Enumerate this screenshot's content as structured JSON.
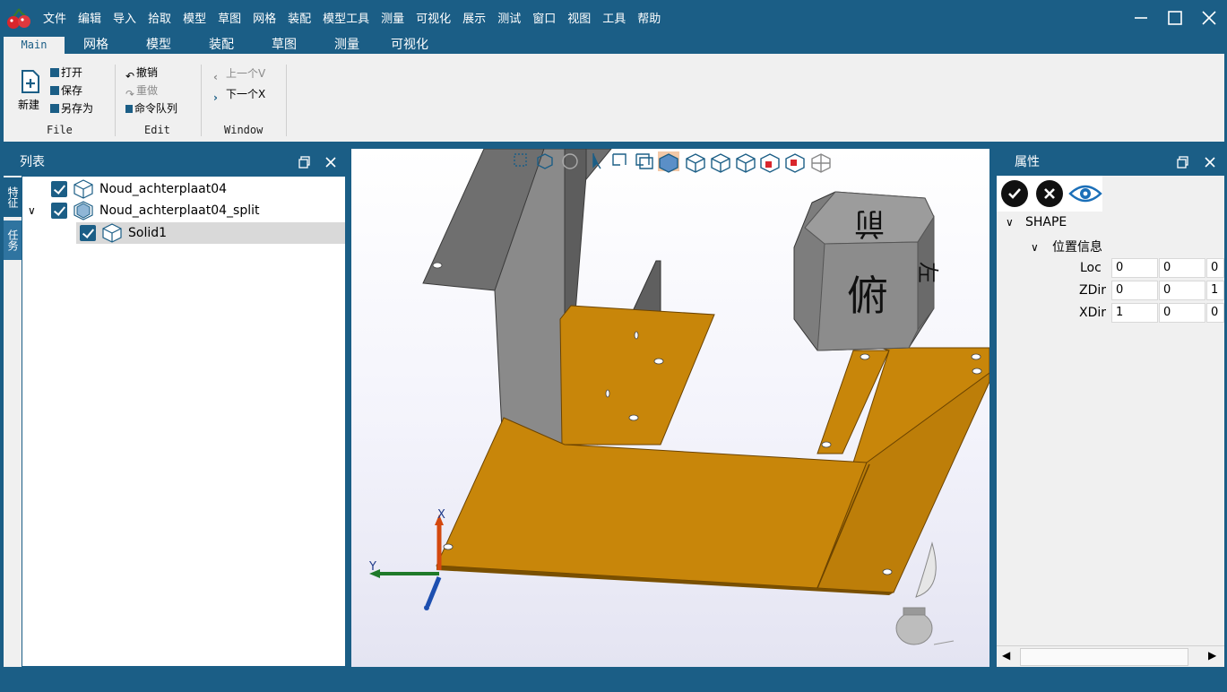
{
  "menu": {
    "items": [
      "文件",
      "编辑",
      "导入",
      "拾取",
      "模型",
      "草图",
      "网格",
      "装配",
      "模型工具",
      "测量",
      "可视化",
      "展示",
      "测试",
      "窗口",
      "视图",
      "工具",
      "帮助"
    ]
  },
  "ribbon_tabs": [
    "Main",
    "网格",
    "模型",
    "装配",
    "草图",
    "测量",
    "可视化"
  ],
  "ribbon": {
    "file_group": {
      "label": "File",
      "new": "新建",
      "open": "打开",
      "save": "保存",
      "save_as": "另存为"
    },
    "edit_group": {
      "label": "Edit",
      "undo": "撤销",
      "redo": "重做",
      "command_queue": "命令队列"
    },
    "window_group": {
      "label": "Window",
      "prev": "上一个V",
      "next": "下一个X"
    }
  },
  "left_panel": {
    "title": "列表",
    "side_tabs": [
      "特征",
      "任务"
    ],
    "tree": [
      {
        "label": "Noud_achterplaat04"
      },
      {
        "label": "Noud_achterplaat04_split"
      },
      {
        "label": "Solid1"
      }
    ]
  },
  "viewport": {
    "view_cube": {
      "front_face": "俯",
      "top_face": "前",
      "side_face": "左"
    },
    "axis": {
      "x": "X",
      "y": "Y"
    }
  },
  "right_panel": {
    "title": "属性",
    "section": "SHAPE",
    "subsection": "位置信息",
    "rows": [
      {
        "label": "Loc",
        "values": [
          "0",
          "0",
          "0"
        ]
      },
      {
        "label": "ZDir",
        "values": [
          "0",
          "0",
          "1"
        ]
      },
      {
        "label": "XDir",
        "values": [
          "1",
          "0",
          "0"
        ]
      }
    ]
  },
  "colors": {
    "primary": "#1b5e86",
    "plate": "#c8860a",
    "plate_edge": "#8a5a00",
    "sheet": "#6e6e6e"
  }
}
